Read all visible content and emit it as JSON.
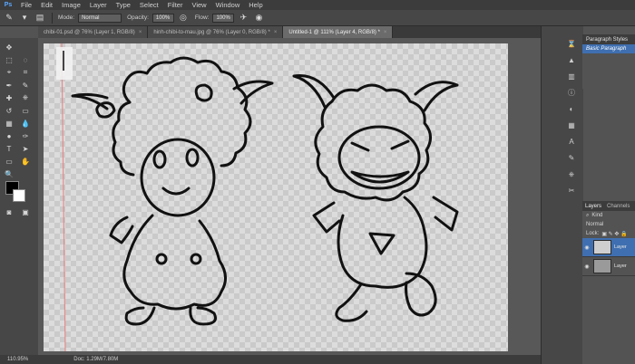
{
  "menubar": {
    "logo": "Ps",
    "items": [
      "File",
      "Edit",
      "Image",
      "Layer",
      "Type",
      "Select",
      "Filter",
      "View",
      "Window",
      "Help"
    ]
  },
  "options": {
    "mode_label": "Mode:",
    "mode_value": "Normal",
    "opacity_label": "Opacity:",
    "opacity_value": "100%",
    "flow_label": "Flow:",
    "flow_value": "100%"
  },
  "tabs": [
    {
      "label": "chibi-01.psd @ 76% (Layer 1, RGB/8)",
      "close": "×",
      "active": false
    },
    {
      "label": "hinh-chibi-to-mau.jpg @ 76% (Layer 0, RGB/8) *",
      "close": "×",
      "active": false
    },
    {
      "label": "Untitled-1 @ 111% (Layer 4, RGB/8) *",
      "close": "×",
      "active": true
    }
  ],
  "status": {
    "zoom": "110.95%",
    "doc": "Doc: 1.29M/7.80M"
  },
  "paragraph_styles": {
    "title": "Paragraph Styles",
    "item": "Basic Paragraph"
  },
  "layers_panel": {
    "tabs": [
      "Layers",
      "Channels"
    ],
    "filter": "Kind",
    "blend": "Normal",
    "lock_label": "Lock:",
    "layers": [
      {
        "name": "Layer"
      },
      {
        "name": "Layer"
      }
    ]
  },
  "icons": {
    "brush": "brush-icon",
    "eye": "eye-icon"
  },
  "colors": {
    "foreground": "#000000",
    "background": "#ffffff",
    "selection": "#3f6fb0"
  }
}
